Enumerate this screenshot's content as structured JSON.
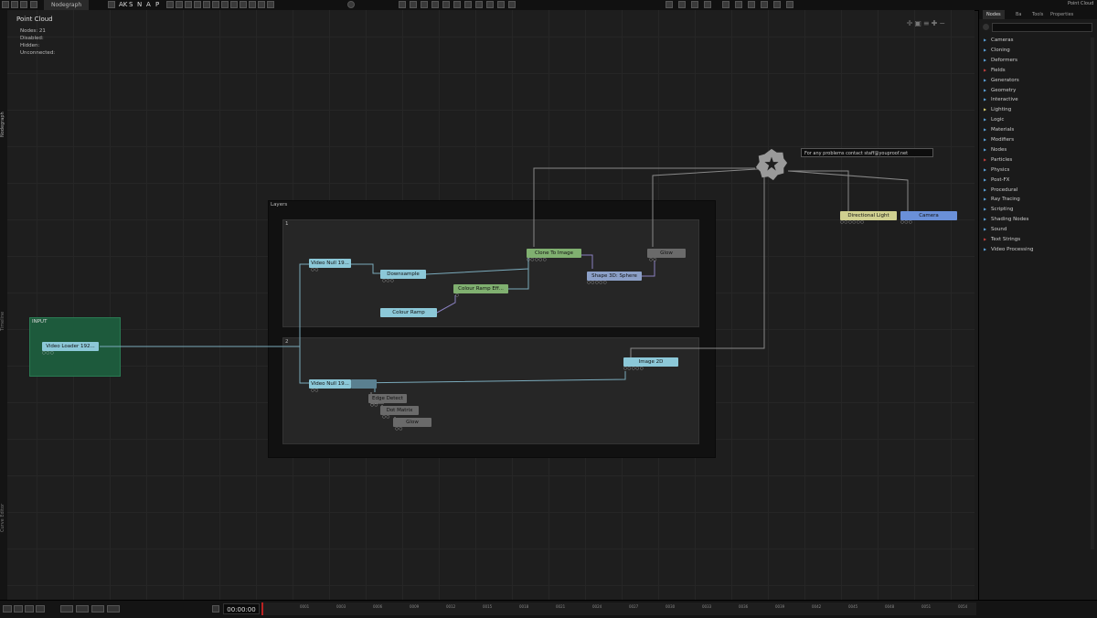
{
  "topbar": {
    "tab_label": "Nodegraph",
    "snap_letters": [
      "AK",
      "S",
      "N",
      "A",
      "P"
    ]
  },
  "sidebar_tabs": [
    "Nodegraph",
    "Timeline",
    "Curve Editor"
  ],
  "overlay": {
    "title": "Point  Cloud",
    "stats": [
      {
        "label": "Nodes:",
        "value": "21"
      },
      {
        "label": "Disabled:",
        "value": ""
      },
      {
        "label": "Hidden:",
        "value": ""
      },
      {
        "label": "Unconnected:",
        "value": ""
      }
    ]
  },
  "groups": {
    "layers": "Layers",
    "layer1": "1",
    "layer2": "2",
    "input": "INPUT"
  },
  "nodes": {
    "video_loader": "Video  Loader  192...",
    "video_null_1": "Video  Null  19...",
    "downsample": "Downsample",
    "colour_ramp": "Colour  Ramp",
    "colour_ramp_effect": "Colour  Ramp  Eff...",
    "clone_to_image": "Clone  To  Image",
    "shape_3d_sphere": "Shape  3D:  Sphere",
    "glow_top": "Glow",
    "video_null_2": "Video  Null  19...",
    "edge_detect": "Edge  Detect",
    "dot_matrix": "Dot  Matrix",
    "glow_bottom": "Glow",
    "image_2d": "Image  2D",
    "directional_light": "Directional  Light",
    "camera": "Camera"
  },
  "note_text": "For  any  problems  contact  staff@youproof.net",
  "right_panel": {
    "tabs": [
      "Nodes",
      "Ba",
      "Tools",
      "Properties"
    ],
    "corner_label": "Point Cloud",
    "categories": [
      {
        "label": "Cameras",
        "color": "#5aa0d8"
      },
      {
        "label": "Cloning",
        "color": "#5aa0d8"
      },
      {
        "label": "Deformers",
        "color": "#5aa0d8"
      },
      {
        "label": "Fields",
        "color": "#c04040"
      },
      {
        "label": "Generators",
        "color": "#5aa0d8"
      },
      {
        "label": "Geometry",
        "color": "#5aa0d8"
      },
      {
        "label": "Interactive",
        "color": "#5aa0d8"
      },
      {
        "label": "Lighting",
        "color": "#d8d070"
      },
      {
        "label": "Logic",
        "color": "#5aa0d8"
      },
      {
        "label": "Materials",
        "color": "#5aa0d8"
      },
      {
        "label": "Modifiers",
        "color": "#5aa0d8"
      },
      {
        "label": "Nodes",
        "color": "#5aa0d8"
      },
      {
        "label": "Particles",
        "color": "#c04040"
      },
      {
        "label": "Physics",
        "color": "#5aa0d8"
      },
      {
        "label": "Post-FX",
        "color": "#5aa0d8"
      },
      {
        "label": "Procedural",
        "color": "#5aa0d8"
      },
      {
        "label": "Ray Tracing",
        "color": "#5aa0d8"
      },
      {
        "label": "Scripting",
        "color": "#5aa0d8"
      },
      {
        "label": "Shading Nodes",
        "color": "#5aa0d8"
      },
      {
        "label": "Sound",
        "color": "#5aa0d8"
      },
      {
        "label": "Text Strings",
        "color": "#c04040"
      },
      {
        "label": "Video Processing",
        "color": "#5aa0d8"
      }
    ]
  },
  "timeline": {
    "time": "00:00:00",
    "ticks": [
      "0001",
      "0003",
      "0006",
      "0009",
      "0012",
      "0015",
      "0018",
      "0021",
      "0024",
      "0027",
      "0030",
      "0033",
      "0036",
      "0039",
      "0042",
      "0045",
      "0048",
      "0051",
      "0054"
    ]
  },
  "colors": {
    "node_cyan": "#8cc8d8",
    "node_green": "#80b070",
    "node_blue": "#8ca0c8",
    "node_gray": "#6a6a6a",
    "node_yellow": "#d0d090",
    "node_camera": "#6a90d8",
    "input_group": "#1d5a3c",
    "wire": "#7aaabb"
  }
}
